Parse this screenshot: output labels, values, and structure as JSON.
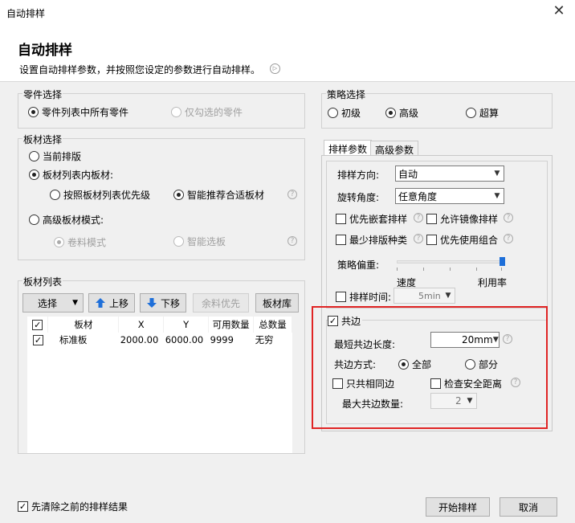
{
  "window": {
    "title": "自动排样",
    "close_glyph": "✕"
  },
  "header": {
    "title": "自动排样",
    "description": "设置自动排样参数，并按照您设定的参数进行自动排样。",
    "play_glyph": "▷"
  },
  "part_select": {
    "title": "零件选择",
    "options": [
      {
        "label": "零件列表中所有零件",
        "selected": true,
        "enabled": true
      },
      {
        "label": "仅勾选的零件",
        "selected": false,
        "enabled": false
      }
    ]
  },
  "sheet_select": {
    "title": "板材选择",
    "current": "当前排版",
    "list_sheets": "板材列表内板材:",
    "by_priority": "按照板材列表优先级",
    "smart_recommend": "智能推荐合适板材",
    "advanced": "高级板材模式:",
    "roll_mode": "卷料模式",
    "smart_select": "智能选板"
  },
  "sheet_list": {
    "title": "板材列表",
    "select_label": "选择",
    "up_label": "上移",
    "down_label": "下移",
    "remnant_label": "余料优先",
    "library_label": "板材库",
    "columns": [
      "板材",
      "X",
      "Y",
      "可用数量",
      "总数量"
    ],
    "rows": [
      {
        "checked": true,
        "name": "标准板",
        "x": "2000.00",
        "y": "6000.00",
        "available": "9999",
        "total": "无穷"
      }
    ]
  },
  "strategy": {
    "title": "策略选择",
    "options": [
      {
        "label": "初级",
        "selected": false
      },
      {
        "label": "高级",
        "selected": true
      },
      {
        "label": "超算",
        "selected": false
      }
    ]
  },
  "tabs": [
    {
      "label": "排样参数",
      "active": true
    },
    {
      "label": "高级参数",
      "active": false
    }
  ],
  "params": {
    "direction_label": "排样方向:",
    "direction_value": "自动",
    "rotation_label": "旋转角度:",
    "rotation_value": "任意角度",
    "nest_first": "优先嵌套排样",
    "allow_mirror": "允许镜像排样",
    "min_types": "最少排版种类",
    "prefer_combo": "优先使用组合",
    "bias_label": "策略偏重:",
    "bias_left": "速度",
    "bias_right": "利用率",
    "bias_value": 1.0,
    "time_label": "排样时间:",
    "time_value": "5min"
  },
  "common_edge": {
    "title": "共边",
    "checked": true,
    "min_length_label": "最短共边长度:",
    "min_length_value": "20mm",
    "mode_label": "共边方式:",
    "mode_all": "全部",
    "mode_partial": "部分",
    "mode_all_selected": true,
    "same_only": "只共相同边",
    "check_safe": "检查安全距离",
    "max_count_label": "最大共边数量:",
    "max_count_value": "2"
  },
  "footer": {
    "clear_previous": "先清除之前的排样结果",
    "clear_checked": true,
    "start_label": "开始排样",
    "cancel_label": "取消"
  },
  "glyphs": {
    "check": "✓",
    "arrow_down": "▼",
    "help": "?"
  },
  "colors": {
    "highlight_border": "#e02424",
    "arrow_blue": "#1e6fd9",
    "slider_thumb": "#1e6fd9"
  }
}
